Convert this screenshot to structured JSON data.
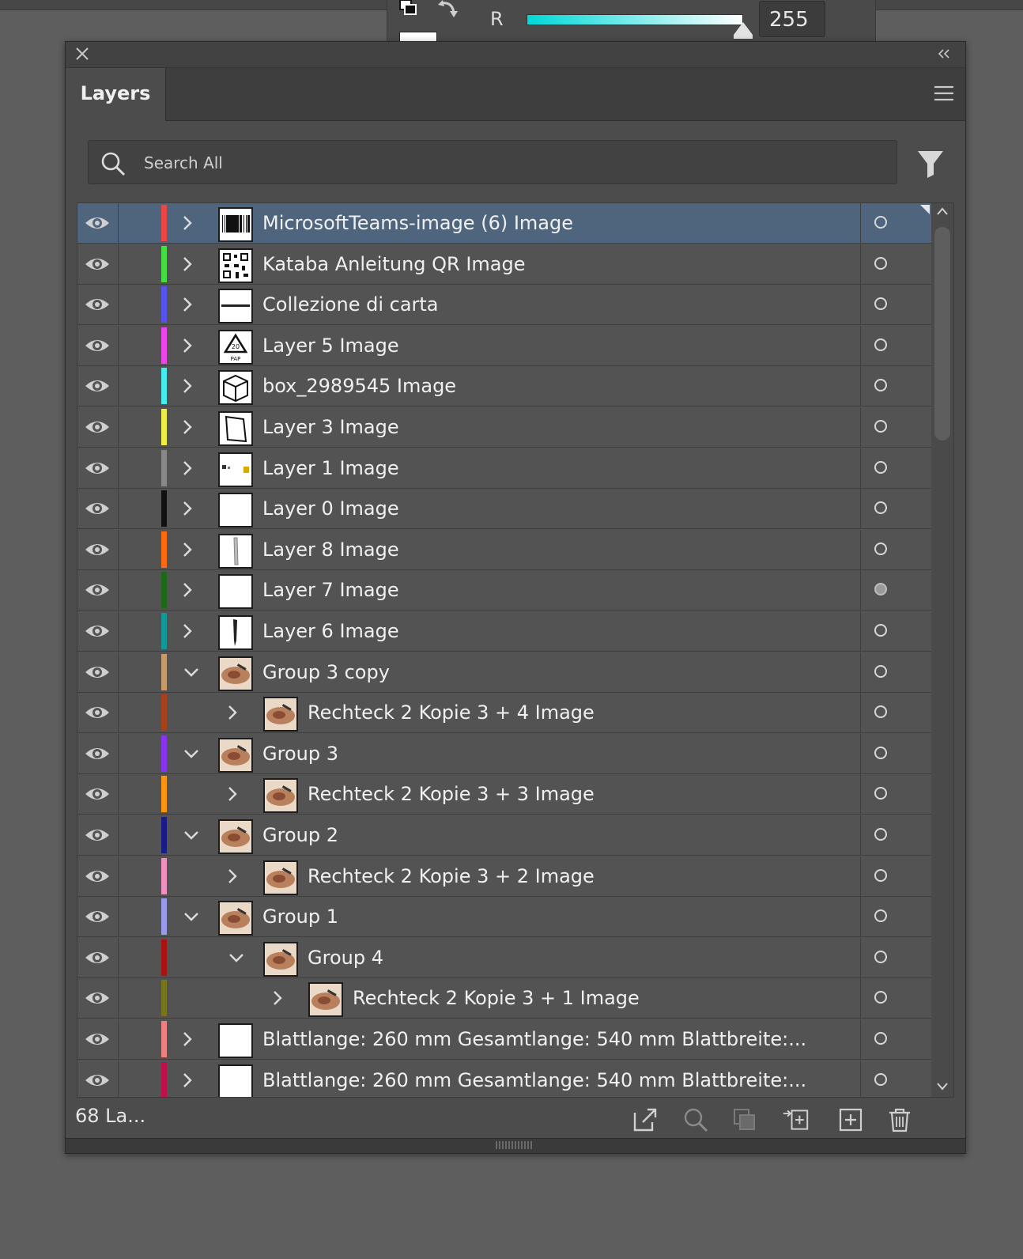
{
  "color_panel": {
    "channel_label": "R",
    "value": "255",
    "slider_fraction": 1.0,
    "gradient_start": "#00d7d7",
    "gradient_end": "#ffffff"
  },
  "panel": {
    "tab_label": "Layers",
    "search_placeholder": "Search All",
    "footer_count": "68 La...",
    "selection_color": "#4f657e"
  },
  "layers": [
    {
      "name": "MicrosoftTeams-image (6) Image",
      "color": "#ee4444",
      "expanded": false,
      "depth": 0,
      "thumb": "barcode",
      "selected": true,
      "target_filled": false
    },
    {
      "name": "Kataba Anleitung QR Image",
      "color": "#44dd44",
      "expanded": false,
      "depth": 0,
      "thumb": "qr",
      "selected": false,
      "target_filled": false
    },
    {
      "name": "Collezione di carta",
      "color": "#5555ee",
      "expanded": false,
      "depth": 0,
      "thumb": "text",
      "selected": false,
      "target_filled": false
    },
    {
      "name": "Layer 5 Image",
      "color": "#ee44ee",
      "expanded": false,
      "depth": 0,
      "thumb": "recycle",
      "selected": false,
      "target_filled": false
    },
    {
      "name": "box_2989545 Image",
      "color": "#44eeee",
      "expanded": false,
      "depth": 0,
      "thumb": "box",
      "selected": false,
      "target_filled": false
    },
    {
      "name": "Layer 3 Image",
      "color": "#eeee44",
      "expanded": false,
      "depth": 0,
      "thumb": "sheet",
      "selected": false,
      "target_filled": false
    },
    {
      "name": "Layer 1 Image",
      "color": "#888888",
      "expanded": false,
      "depth": 0,
      "thumb": "dots",
      "selected": false,
      "target_filled": false
    },
    {
      "name": "Layer 0 Image",
      "color": "#111111",
      "expanded": false,
      "depth": 0,
      "thumb": "blank",
      "selected": false,
      "target_filled": false
    },
    {
      "name": "Layer 8 Image",
      "color": "#ff6a10",
      "expanded": false,
      "depth": 0,
      "thumb": "blade",
      "selected": false,
      "target_filled": false
    },
    {
      "name": "Layer 7 Image",
      "color": "#1a6a1a",
      "expanded": false,
      "depth": 0,
      "thumb": "blank",
      "selected": false,
      "target_filled": true
    },
    {
      "name": "Layer 6 Image",
      "color": "#119999",
      "expanded": false,
      "depth": 0,
      "thumb": "knife",
      "selected": false,
      "target_filled": false
    },
    {
      "name": "Group 3 copy",
      "color": "#c69a6a",
      "expanded": true,
      "depth": 0,
      "thumb": "photo",
      "selected": false,
      "target_filled": false
    },
    {
      "name": "Rechteck 2 Kopie 3 + 4 Image",
      "color": "#a8401c",
      "expanded": false,
      "depth": 1,
      "thumb": "photo",
      "selected": false,
      "target_filled": false
    },
    {
      "name": "Group 3",
      "color": "#8833ee",
      "expanded": true,
      "depth": 0,
      "thumb": "photo",
      "selected": false,
      "target_filled": false
    },
    {
      "name": "Rechteck 2 Kopie 3 + 3 Image",
      "color": "#ff9410",
      "expanded": false,
      "depth": 1,
      "thumb": "photo",
      "selected": false,
      "target_filled": false
    },
    {
      "name": "Group 2",
      "color": "#1a1a88",
      "expanded": true,
      "depth": 0,
      "thumb": "photo",
      "selected": false,
      "target_filled": false
    },
    {
      "name": "Rechteck 2 Kopie 3 + 2 Image",
      "color": "#f090c0",
      "expanded": false,
      "depth": 1,
      "thumb": "photo",
      "selected": false,
      "target_filled": false
    },
    {
      "name": "Group 1",
      "color": "#9999ee",
      "expanded": true,
      "depth": 0,
      "thumb": "photo",
      "selected": false,
      "target_filled": false
    },
    {
      "name": "Group 4",
      "color": "#aa1111",
      "expanded": true,
      "depth": 1,
      "thumb": "photo",
      "selected": false,
      "target_filled": false
    },
    {
      "name": "Rechteck 2 Kopie 3 + 1 Image",
      "color": "#77771a",
      "expanded": false,
      "depth": 2,
      "thumb": "photo",
      "selected": false,
      "target_filled": false
    },
    {
      "name": "Blattlange: 260 mm Gesamtlange: 540 mm Blattbreite:...",
      "color": "#f08080",
      "expanded": false,
      "depth": 0,
      "thumb": "blank",
      "selected": false,
      "target_filled": false
    },
    {
      "name": "Blattlange: 260 mm Gesamtlange: 540 mm Blattbreite:...",
      "color": "#c0104a",
      "expanded": false,
      "depth": 0,
      "thumb": "blank",
      "selected": false,
      "target_filled": false
    }
  ],
  "icons": {
    "visibility": "eye-icon",
    "expand": "chevron-right-icon",
    "collapse": "chevron-down-icon",
    "target": "target-circle-icon",
    "footer": [
      "export-icon",
      "locate-object-icon",
      "make-clipping-mask-icon",
      "create-sublayer-icon",
      "new-layer-icon",
      "trash-icon"
    ]
  }
}
